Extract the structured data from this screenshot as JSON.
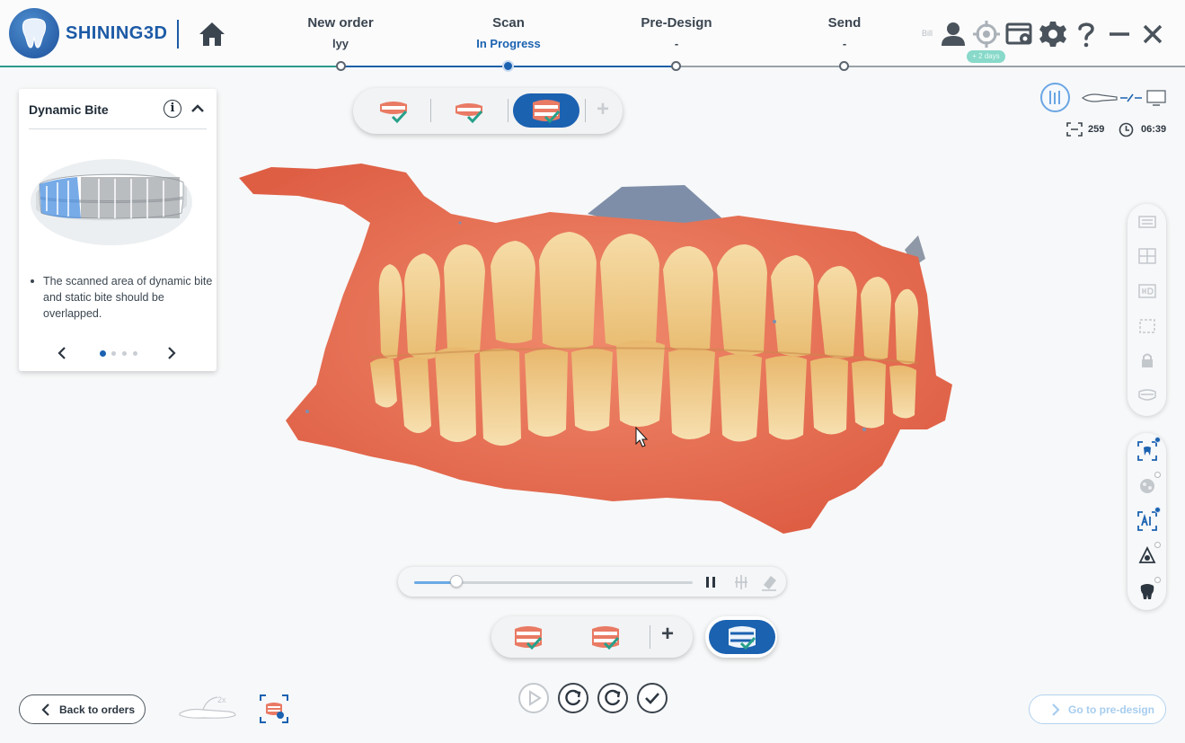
{
  "brand": {
    "name": "SHINING3D"
  },
  "steps": [
    {
      "title": "New order",
      "sub": "lyy"
    },
    {
      "title": "Scan",
      "sub": "In Progress"
    },
    {
      "title": "Pre-Design",
      "sub": "-"
    },
    {
      "title": "Send",
      "sub": "-"
    }
  ],
  "toolbar": {
    "bill_label": "Bill",
    "days_badge": "+ 2 days",
    "icons": [
      "user-icon",
      "target-icon",
      "screen-icon",
      "gear-icon",
      "help-icon",
      "minimize-icon",
      "close-icon"
    ]
  },
  "guide": {
    "title": "Dynamic Bite",
    "info_glyph": "i",
    "text": "The scanned area of dynamic bite and static bite should be overlapped.",
    "page_current": 1,
    "page_count": 4
  },
  "stats": {
    "count": "259",
    "time": "06:39"
  },
  "playback": {
    "progress": 0.15
  },
  "buttons": {
    "back": "Back to orders",
    "next": "Go to pre-design"
  },
  "colors": {
    "accent": "#1b62b1",
    "done": "#2a9a8c",
    "gum": "#e4694e",
    "tooth": "#f1cf93"
  }
}
